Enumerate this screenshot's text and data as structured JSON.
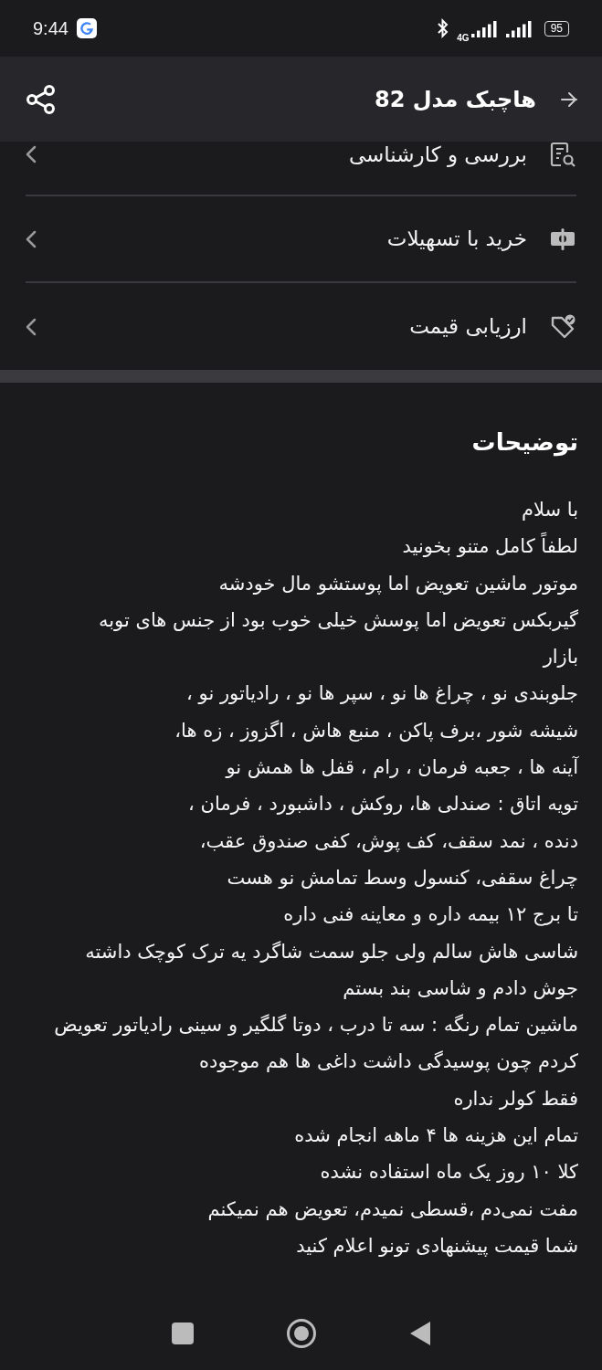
{
  "status_bar": {
    "time": "9:44",
    "network": "4G",
    "battery": "95"
  },
  "header": {
    "title": "هاچبک مدل 82"
  },
  "menu_items": [
    {
      "kind": "inspection",
      "label": "بررسی و کارشناسی"
    },
    {
      "kind": "installment",
      "label": "خرید با تسهیلات"
    },
    {
      "kind": "price",
      "label": "ارزیابی قیمت"
    }
  ],
  "description": {
    "title": "توضیحات",
    "lines": [
      "با سلام",
      "لطفاً کامل متنو بخونید",
      "موتور ماشین تعویض اما پوستشو مال خودشه",
      "گیربکس تعویض اما پوسش خیلی خوب بود از جنس های توبه",
      "بازار",
      "جلوبندی نو ، چراغ ها نو ، سپر ها نو ، رادیاتور نو ،",
      "شیشه شور ،برف پاکن ، منبع هاش ، اگزوز ، زه ها،",
      "آینه ها ، جعبه فرمان ، رام ، قفل ها همش نو",
      "تویه اتاق : صندلی ها، روکش ، داشبورد ، فرمان ،",
      "دنده ، نمد سقف، کف پوش، کفی صندوق عقب،",
      "چراغ سقفی، کنسول وسط تمامش نو هست",
      "تا برج ۱۲ بیمه داره و معاینه فنی داره",
      "شاسی هاش سالم ولی جلو سمت شاگرد یه ترک کوچک داشته",
      "جوش دادم و شاسی بند بستم",
      "ماشین تمام رنگه : سه تا درب ، دوتا گلگیر و سینی رادیاتور تعویض",
      "کردم چون پوسیدگی داشت داغی ها هم موجوده",
      "فقط کولر نداره",
      "تمام این هزینه ها ۴ ماهه انجام شده",
      "کلا ۱۰ روز یک ماه استفاده نشده",
      "مفت نمی‌دم ،قسطی نمیدم، تعویض هم نمیکنم",
      "شما قیمت پیشنهادی تونو اعلام کنید"
    ]
  }
}
